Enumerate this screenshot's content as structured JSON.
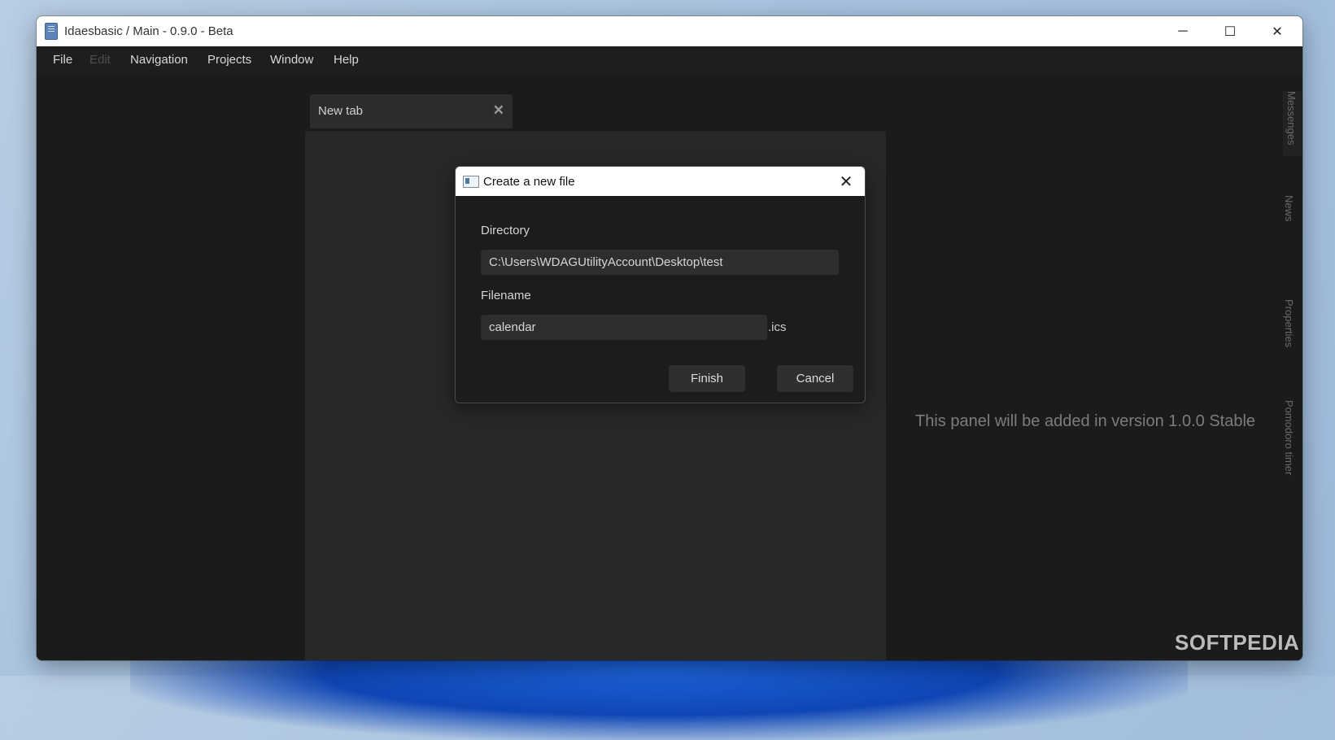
{
  "window": {
    "title": "Idaesbasic / Main - 0.9.0 - Beta",
    "controls": {
      "minimize": "─",
      "maximize": "☐",
      "close": "✕"
    }
  },
  "menu": {
    "items": [
      {
        "label": "File",
        "enabled": true
      },
      {
        "label": "Edit",
        "enabled": false
      },
      {
        "label": "Navigation",
        "enabled": true
      },
      {
        "label": "Projects",
        "enabled": true
      },
      {
        "label": "Window",
        "enabled": true
      },
      {
        "label": "Help",
        "enabled": true
      }
    ]
  },
  "tabs": [
    {
      "label": "New tab",
      "close": "✕"
    }
  ],
  "right_panel": {
    "message": "This panel will be added in version 1.0.0 Stable"
  },
  "side_tabs": [
    {
      "label": "Messenges"
    },
    {
      "label": "News"
    },
    {
      "label": "Properties"
    },
    {
      "label": "Pomodoro timer"
    }
  ],
  "dialog": {
    "title": "Create a new file",
    "close": "✕",
    "directory_label": "Directory",
    "directory_value": "C:\\Users\\WDAGUtilityAccount\\Desktop\\test",
    "filename_label": "Filename",
    "filename_value": "calendar",
    "extension": ".ics",
    "finish_label": "Finish",
    "cancel_label": "Cancel"
  },
  "watermark": "SOFTPEDIA"
}
